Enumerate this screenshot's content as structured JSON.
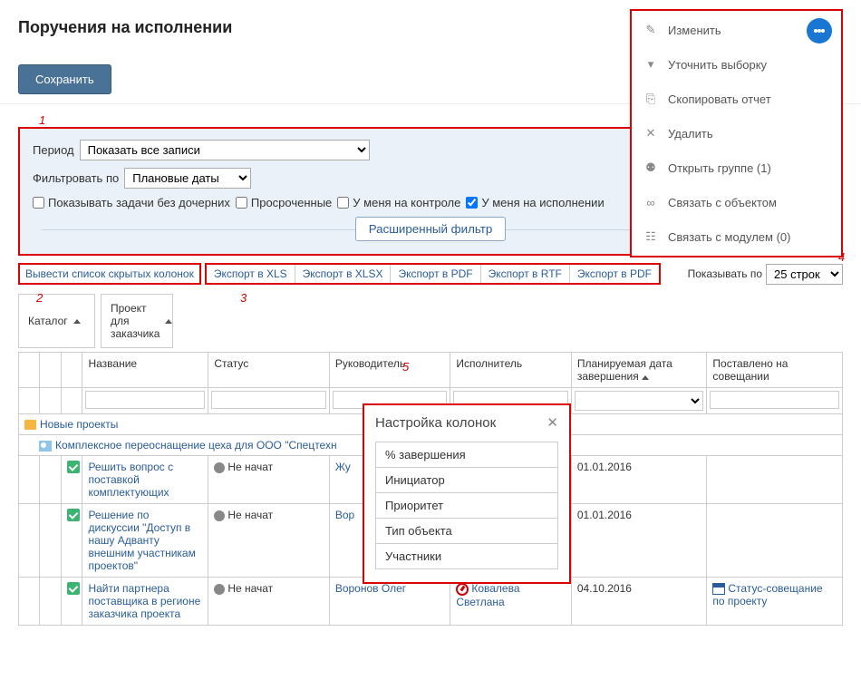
{
  "header": {
    "title": "Поручения на исполнении",
    "save": "Сохранить"
  },
  "context_menu": {
    "items": [
      {
        "icon": "pencil",
        "label": "Изменить"
      },
      {
        "icon": "funnel",
        "label": "Уточнить выборку"
      },
      {
        "icon": "copy",
        "label": "Скопировать отчет"
      },
      {
        "icon": "x",
        "label": "Удалить"
      },
      {
        "icon": "group",
        "label": "Открыть группе (1)"
      },
      {
        "icon": "link",
        "label": "Связать с объектом"
      },
      {
        "icon": "module",
        "label": "Связать с модулем (0)"
      }
    ]
  },
  "filters": {
    "period_label": "Период",
    "period_value": "Показать все записи",
    "filterby_label": "Фильтровать по",
    "filterby_value": "Плановые даты",
    "checks": [
      {
        "label": "Показывать задачи без дочерних",
        "checked": false
      },
      {
        "label": "Просроченные",
        "checked": false
      },
      {
        "label": "У меня на контроле",
        "checked": false
      },
      {
        "label": "У меня на исполнении",
        "checked": true
      }
    ],
    "advanced": "Расширенный фильтр"
  },
  "toolbar": {
    "hidden_cols": "Вывести список скрытых колонок",
    "exports": [
      "Экспорт в XLS",
      "Экспорт в XLSX",
      "Экспорт в PDF",
      "Экспорт в RTF",
      "Экспорт в PDF"
    ],
    "rows_label": "Показывать по",
    "rows_value": "25 строк"
  },
  "annotations": {
    "a1": "1",
    "a2": "2",
    "a3": "3",
    "a4": "4",
    "a5": "5"
  },
  "group_headers": {
    "g1": "Каталог",
    "g2": "Проект для заказчика"
  },
  "columns": [
    "Название",
    "Статус",
    "Руководитель",
    "Исполнитель",
    "Планируемая дата завершения",
    "Поставлено на совещании"
  ],
  "categories": {
    "c1": "Новые проекты",
    "c2": "Комплексное переоснащение цеха для ООО \"Спецтехн"
  },
  "rows": [
    {
      "name": "Решить вопрос с поставкой комплектующих",
      "status": "Не начат",
      "manager": "Жу",
      "executor": "",
      "date": "01.01.2016",
      "meeting": ""
    },
    {
      "name": "Решение по дискуссии \"Доступ в нашу Адванту внешним участникам проектов\"",
      "status": "Не начат",
      "manager": "Вор",
      "executor": "",
      "date": "01.01.2016",
      "meeting": ""
    },
    {
      "name": "Найти партнера поставщика в регионе заказчика проекта",
      "status": "Не начат",
      "manager": "Воронов Олег",
      "executor": "Ковалева Светлана",
      "date": "04.10.2016",
      "meeting": "Статус-совещание по проекту"
    }
  ],
  "column_popup": {
    "title": "Настройка колонок",
    "items": [
      "% завершения",
      "Инициатор",
      "Приоритет",
      "Тип объекта",
      "Участники"
    ]
  }
}
